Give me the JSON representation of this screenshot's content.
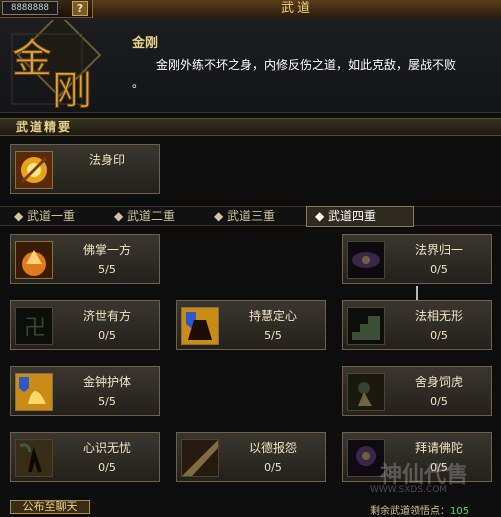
{
  "window": {
    "title": "武道",
    "badge": "8888888",
    "help_label": "?"
  },
  "header": {
    "emblem_text": "金刚",
    "skill_title": "金刚",
    "skill_desc": "金刚外练不坏之身，内修反伤之道，如此克敌，屡战不败",
    "skill_desc_end": "。"
  },
  "essence_section": {
    "title": "武道精要",
    "skill": {
      "name": "法身印",
      "icon": "golden-seal-icon"
    }
  },
  "tabs": [
    {
      "label": "武道一重",
      "active": false
    },
    {
      "label": "武道二重",
      "active": false
    },
    {
      "label": "武道三重",
      "active": false
    },
    {
      "label": "武道四重",
      "active": true
    }
  ],
  "skills": [
    {
      "name": "佛掌一方",
      "level": "5/5",
      "icon": "buddha-palm-icon",
      "locked": false
    },
    {
      "name": "法界归一",
      "level": "0/5",
      "icon": "purple-eye-icon",
      "locked": true
    },
    {
      "name": "济世有方",
      "level": "0/5",
      "icon": "swastika-icon",
      "locked": true
    },
    {
      "name": "持慧定心",
      "level": "5/5",
      "icon": "blue-shield-warrior-icon",
      "locked": false
    },
    {
      "name": "法相无形",
      "level": "0/5",
      "icon": "green-stairs-icon",
      "locked": true
    },
    {
      "name": "金钟护体",
      "level": "5/5",
      "icon": "golden-bell-icon",
      "locked": false
    },
    {
      "name": "舍身饲虎",
      "level": "0/5",
      "icon": "tiger-icon",
      "locked": true
    },
    {
      "name": "心识无忧",
      "level": "0/5",
      "icon": "green-spirit-icon",
      "locked": true
    },
    {
      "name": "以德报怨",
      "level": "0/5",
      "icon": "light-beam-icon",
      "locked": true
    },
    {
      "name": "拜请佛陀",
      "level": "0/5",
      "icon": "purple-buddha-icon",
      "locked": true
    }
  ],
  "footer": {
    "chat_button": "公布至聊天",
    "remain_label": "剩余武道领悟点：",
    "remain_value": "105"
  },
  "watermark": {
    "text": "神仙代售",
    "url": "WWW.SXDS.COM"
  },
  "colors": {
    "accent": "#e7cf87",
    "background": "#0d0d0d",
    "points": "#4ee04e"
  }
}
